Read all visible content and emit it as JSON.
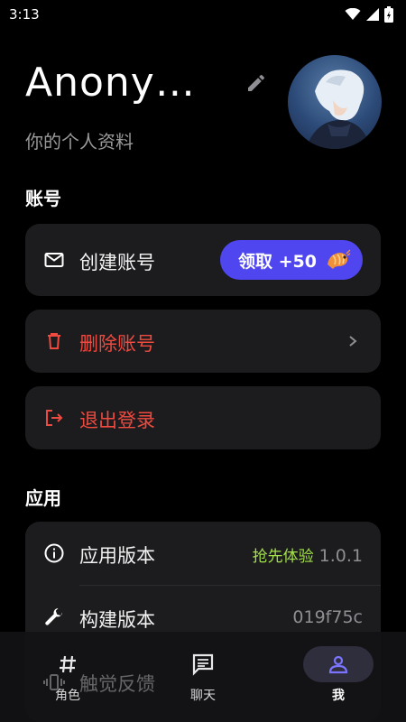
{
  "status_bar": {
    "time": "3:13"
  },
  "profile": {
    "name": "Anonym…",
    "subtitle": "你的个人资料"
  },
  "account_section": {
    "title": "账号",
    "create_account": {
      "label": "创建账号",
      "claim_label": "领取 +50"
    },
    "delete_account": {
      "label": "删除账号"
    },
    "logout": {
      "label": "退出登录"
    }
  },
  "app_section": {
    "title": "应用",
    "app_version": {
      "label": "应用版本",
      "badge": "抢先体验",
      "value": "1.0.1"
    },
    "build_version": {
      "label": "构建版本",
      "value": "019f75c"
    },
    "haptic": {
      "label": "触觉反馈"
    }
  },
  "bottom_nav": {
    "items": [
      {
        "label": "角色",
        "icon": "hash-icon"
      },
      {
        "label": "聊天",
        "icon": "chat-icon"
      },
      {
        "label": "我",
        "icon": "person-icon",
        "active": true
      }
    ]
  },
  "colors": {
    "accent": "#4f46f0",
    "danger": "#ef4a3f",
    "early_access": "#a3e04a",
    "card_bg": "#1c1c1e"
  }
}
